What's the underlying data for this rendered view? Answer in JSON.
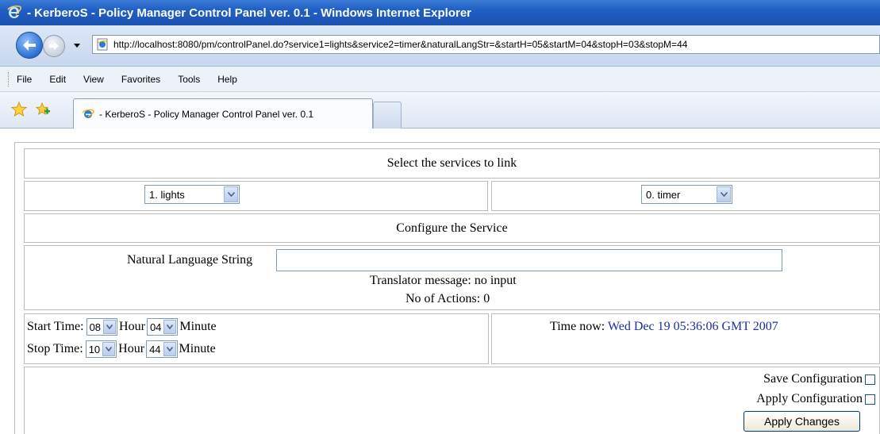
{
  "window": {
    "title": "- KerberoS - Policy Manager Control Panel ver. 0.1 - Windows Internet Explorer"
  },
  "address": {
    "url": "http://localhost:8080/pm/controlPanel.do?service1=lights&service2=timer&naturalLangStr=&startH=05&startM=04&stopH=03&stopM=44"
  },
  "menu": {
    "items": [
      "File",
      "Edit",
      "View",
      "Favorites",
      "Tools",
      "Help"
    ]
  },
  "tab": {
    "label": "- KerberoS - Policy Manager Control Panel ver. 0.1"
  },
  "panel": {
    "select_heading": "Select the services to link",
    "service1": "1. lights",
    "service2": "0. timer",
    "configure_heading": "Configure the Service",
    "nl_label": "Natural Language String",
    "nl_value": "",
    "translator_message": "Translator message: no input",
    "actions_count": "No of Actions: 0",
    "start_label": "Start Time:",
    "start_hour": "08",
    "start_minute": "04",
    "stop_label": "Stop Time:",
    "stop_hour": "10",
    "stop_minute": "44",
    "hour_unit": "Hour",
    "minute_unit": "Minute",
    "time_now_label": "Time now:",
    "time_now_value": "Wed Dec 19 05:36:06 GMT 2007",
    "save_config_label": "Save Configuration",
    "apply_config_label": "Apply Configuration",
    "apply_button": "Apply Changes"
  },
  "colors": {
    "title_bar": "#1f5fc4",
    "time_value": "#1a2fa0"
  }
}
